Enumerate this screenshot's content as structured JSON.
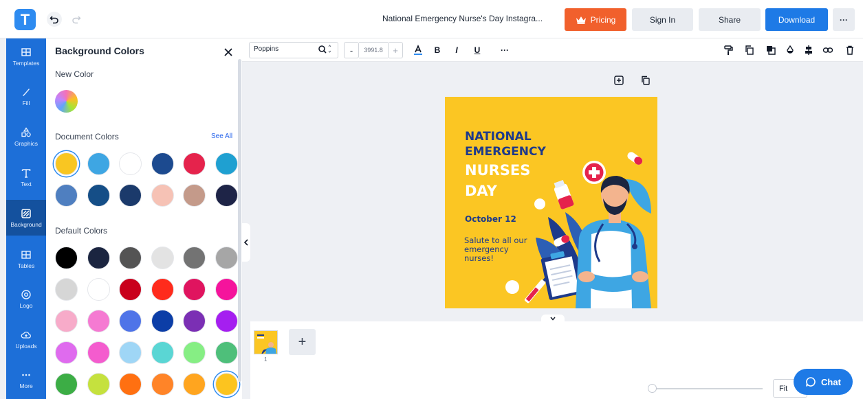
{
  "app": {
    "logo_letter": "T",
    "document_title": "National Emergency Nurse's Day Instagra...",
    "buttons": {
      "pricing": "Pricing",
      "sign_in": "Sign In",
      "share": "Share",
      "download": "Download",
      "more": "···"
    },
    "colors": {
      "brand": "#1e7ae6",
      "pricing": "#f1602c",
      "rail": "#1d6fd8"
    }
  },
  "rail": {
    "items": [
      {
        "label": "Templates",
        "icon": "templates-icon"
      },
      {
        "label": "Fill",
        "icon": "brush-icon"
      },
      {
        "label": "Graphics",
        "icon": "shapes-icon"
      },
      {
        "label": "Text",
        "icon": "text-icon"
      },
      {
        "label": "Background",
        "icon": "background-icon"
      },
      {
        "label": "Tables",
        "icon": "table-icon"
      },
      {
        "label": "Logo",
        "icon": "logo-icon"
      },
      {
        "label": "Uploads",
        "icon": "cloud-upload-icon"
      },
      {
        "label": "More",
        "icon": "more-dots-icon"
      }
    ],
    "active": "Background"
  },
  "panel": {
    "title": "Background Colors",
    "new_color_label": "New Color",
    "document_colors_label": "Document Colors",
    "see_all": "See All",
    "default_colors_label": "Default Colors",
    "document_colors": [
      "#f9c622",
      "#3ea6e3",
      "#ffffff",
      "#1c4a8f",
      "#e5234c",
      "#1fa0d1",
      "#4f7fc0",
      "#154e87",
      "#1b3a6b",
      "#f6c2b5",
      "#c49a8a",
      "#1e2447"
    ],
    "document_selected": 0,
    "default_colors": [
      "#000000",
      "#1b2540",
      "#545454",
      "#e3e3e3",
      "#737373",
      "#a6a6a6",
      "#d6d6d6",
      "#ffffff",
      "#c9001c",
      "#ff2b1c",
      "#e0145f",
      "#f5149c",
      "#f7abc9",
      "#f57ad2",
      "#4f74e8",
      "#0c3ea7",
      "#7b2fb4",
      "#a51ff0",
      "#df6bee",
      "#f45cce",
      "#9fd6f6",
      "#5ad6d4",
      "#86ee84",
      "#4ebf7a",
      "#3cad45",
      "#c5e13e",
      "#ff7011",
      "#ff8428",
      "#ffa51f",
      "#fcc41f"
    ],
    "default_selected": 29
  },
  "toolbar": {
    "font": "Poppins",
    "font_size": "3991.8",
    "minus": "-",
    "plus": "+",
    "bold": "B",
    "italic": "I",
    "underline": "U",
    "more": "···"
  },
  "canvas": {
    "line1": "NATIONAL",
    "line2": "EMERGENCY",
    "line3": "NURSES",
    "line4": "DAY",
    "date": "October 12",
    "subtitle": "Salute to all our emergency nurses!"
  },
  "pages": {
    "page_number": "1",
    "add_page": "+",
    "fit": "Fit",
    "chat": "Chat"
  }
}
